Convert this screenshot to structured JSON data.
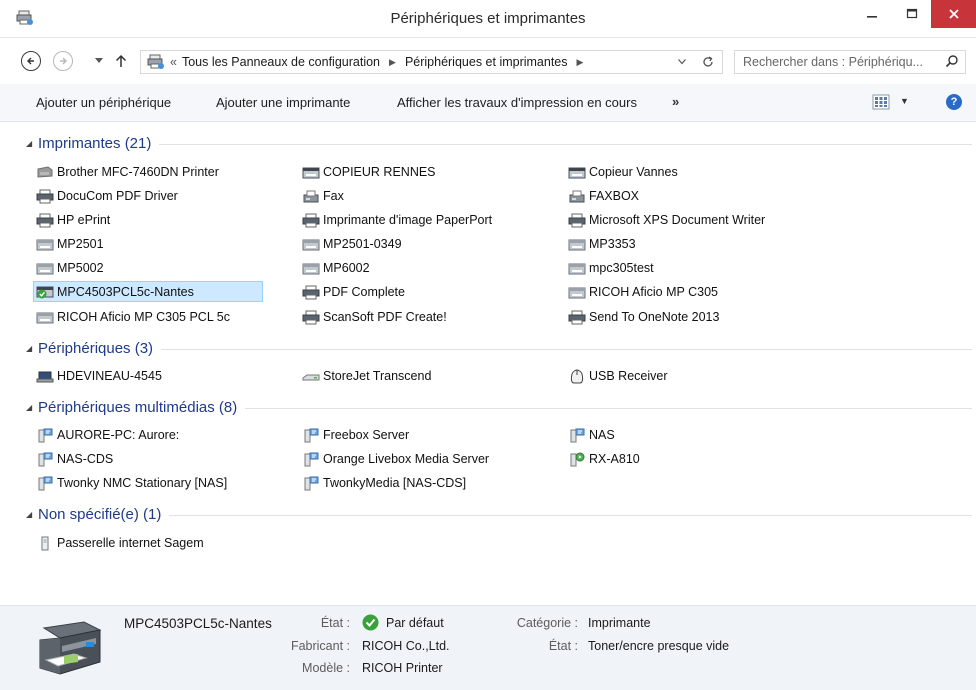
{
  "window": {
    "title": "Périphériques et imprimantes"
  },
  "address": {
    "lead": "«",
    "crumbs": [
      "Tous les Panneaux de configuration",
      "Périphériques et imprimantes"
    ]
  },
  "search": {
    "placeholder": "Rechercher dans : Périphériqu..."
  },
  "commands": {
    "add_device": "Ajouter un périphérique",
    "add_printer": "Ajouter une imprimante",
    "print_jobs": "Afficher les travaux d'impression en cours",
    "more": "»"
  },
  "groups": {
    "printers": {
      "title": "Imprimantes (21)",
      "items": [
        {
          "label": "Brother MFC-7460DN Printer",
          "icon": "printer-grey-icon"
        },
        {
          "label": "COPIEUR RENNES",
          "icon": "copier-icon"
        },
        {
          "label": "Copieur Vannes",
          "icon": "copier-icon"
        },
        {
          "label": "DocuCom PDF Driver",
          "icon": "printer-icon"
        },
        {
          "label": "Fax",
          "icon": "fax-icon"
        },
        {
          "label": "FAXBOX",
          "icon": "fax-icon"
        },
        {
          "label": "HP ePrint",
          "icon": "printer-icon"
        },
        {
          "label": "Imprimante d'image PaperPort",
          "icon": "printer-icon"
        },
        {
          "label": "Microsoft XPS Document Writer",
          "icon": "printer-icon"
        },
        {
          "label": "MP2501",
          "icon": "copier-icon"
        },
        {
          "label": "MP2501-0349",
          "icon": "copier-icon"
        },
        {
          "label": "MP3353",
          "icon": "copier-icon"
        },
        {
          "label": "MP5002",
          "icon": "copier-icon"
        },
        {
          "label": "MP6002",
          "icon": "copier-icon"
        },
        {
          "label": "mpc305test",
          "icon": "copier-icon"
        },
        {
          "label": "MPC4503PCL5c-Nantes",
          "icon": "default-printer-icon",
          "selected": true
        },
        {
          "label": "PDF Complete",
          "icon": "printer-icon"
        },
        {
          "label": "RICOH Aficio MP C305",
          "icon": "copier-icon"
        },
        {
          "label": "RICOH Aficio MP C305 PCL 5c",
          "icon": "copier-icon"
        },
        {
          "label": "ScanSoft PDF Create!",
          "icon": "printer-icon"
        },
        {
          "label": "Send To OneNote 2013",
          "icon": "printer-icon"
        }
      ]
    },
    "devices": {
      "title": "Périphériques (3)",
      "items": [
        {
          "label": "HDEVINEAU-4545",
          "icon": "laptop-icon"
        },
        {
          "label": "StoreJet Transcend",
          "icon": "drive-icon"
        },
        {
          "label": "USB Receiver",
          "icon": "mouse-icon"
        }
      ]
    },
    "multimedia": {
      "title": "Périphériques multimédias (8)",
      "items": [
        {
          "label": "AURORE-PC: Aurore:",
          "icon": "media-server-icon"
        },
        {
          "label": "Freebox Server",
          "icon": "media-server-icon"
        },
        {
          "label": "NAS",
          "icon": "media-server-icon"
        },
        {
          "label": "NAS-CDS",
          "icon": "media-server-icon"
        },
        {
          "label": "Orange Livebox Media Server",
          "icon": "media-server-icon"
        },
        {
          "label": "RX-A810",
          "icon": "media-receiver-icon"
        },
        {
          "label": "Twonky NMC Stationary [NAS]",
          "icon": "media-server-icon"
        },
        {
          "label": "TwonkyMedia [NAS-CDS]",
          "icon": "media-server-icon"
        }
      ]
    },
    "unspecified": {
      "title": "Non spécifié(e) (1)",
      "items": [
        {
          "label": "Passerelle internet Sagem",
          "icon": "gateway-icon"
        }
      ]
    }
  },
  "details": {
    "name": "MPC4503PCL5c-Nantes",
    "state_label": "État :",
    "state_value": "Par défaut",
    "maker_label": "Fabricant :",
    "maker_value": "RICOH Co.,Ltd.",
    "model_label": "Modèle :",
    "model_value": "RICOH Printer",
    "category_label": "Catégorie :",
    "category_value": "Imprimante",
    "status_label": "État :",
    "status_value": "Toner/encre presque vide"
  },
  "colors": {
    "group_title": "#1e3b8a",
    "selection_fill": "#cde8ff",
    "selection_border": "#99d1ff",
    "close_button": "#c7343a",
    "details_bg": "#f0f4f9"
  }
}
